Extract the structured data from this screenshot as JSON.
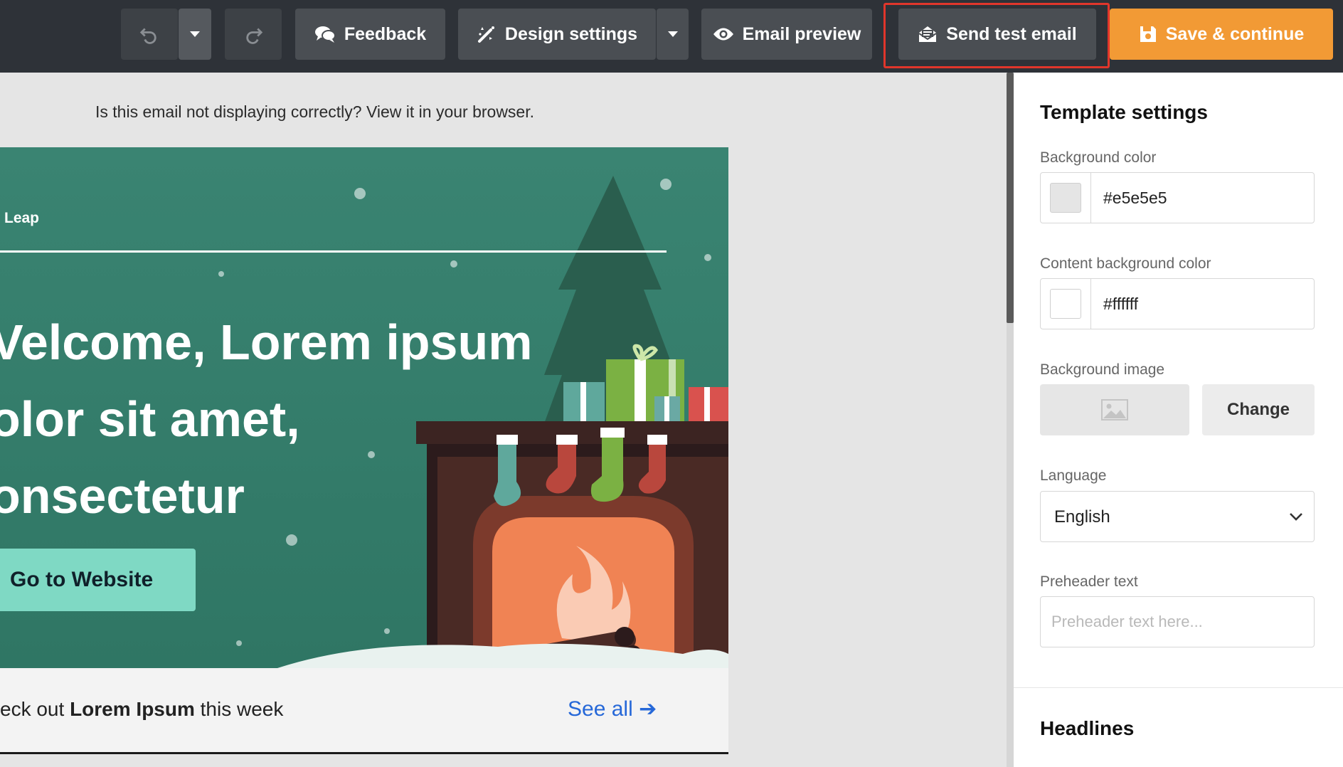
{
  "toolbar": {
    "undo_icon": "undo-icon",
    "redo_icon": "redo-icon",
    "feedback_label": "Feedback",
    "design_settings_label": "Design settings",
    "email_preview_label": "Email preview",
    "send_test_label": "Send test email",
    "save_label": "Save & continue",
    "save_color": "#f29a35",
    "highlight_color": "#e0362b"
  },
  "email": {
    "notice": "Is this email not displaying correctly? View it in your browser.",
    "brand": "Leap",
    "headline_lines": [
      "Velcome, Lorem ipsum",
      "olor sit amet,",
      "onsectetur"
    ],
    "cta_label": "Go to Website",
    "strip_prefix": "eck out ",
    "strip_bold": "Lorem Ipsum",
    "strip_suffix": " this week",
    "see_all": "See all ➔",
    "hero_color": "#3a8472",
    "cta_color": "#7fd9c4"
  },
  "panel": {
    "title": "Template settings",
    "bg_color_label": "Background color",
    "bg_color_value": "#e5e5e5",
    "content_bg_label": "Content background color",
    "content_bg_value": "#ffffff",
    "bg_image_label": "Background image",
    "change_label": "Change",
    "language_label": "Language",
    "language_value": "English",
    "preheader_label": "Preheader text",
    "preheader_placeholder": "Preheader text here...",
    "headlines_title": "Headlines"
  }
}
